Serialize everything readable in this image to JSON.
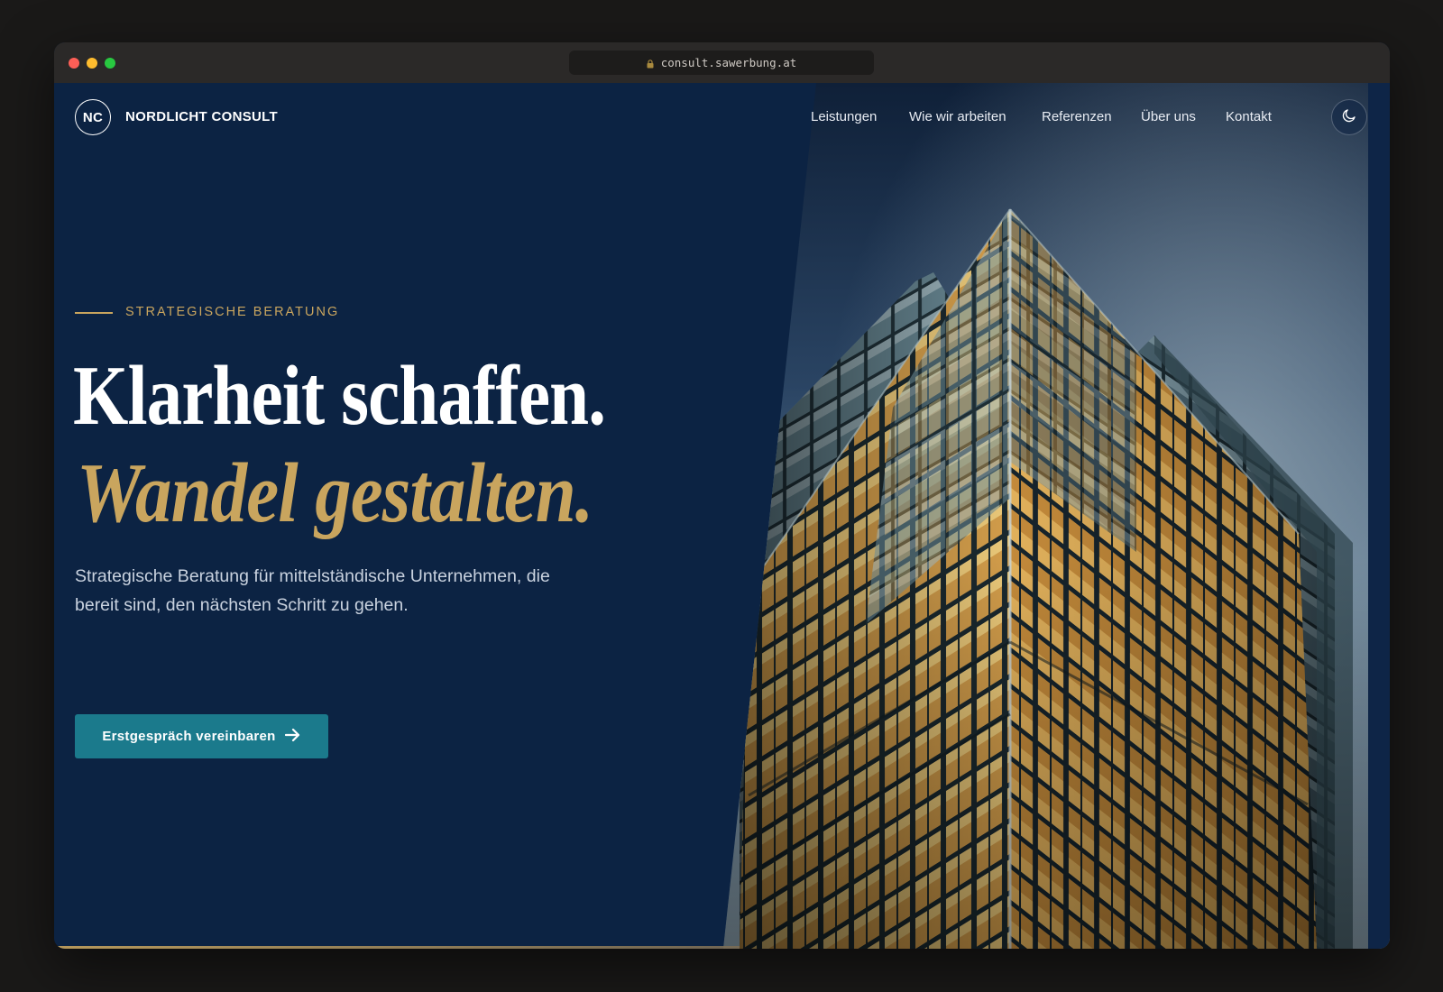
{
  "browser": {
    "url": "consult.sawerbung.at"
  },
  "header": {
    "logo_mark": "NC",
    "brand": "NORDLICHT CONSULT",
    "nav": [
      {
        "label": "Leistungen"
      },
      {
        "label": "Wie wir arbeiten"
      },
      {
        "label": "Referenzen"
      },
      {
        "label": "Über uns"
      },
      {
        "label": "Kontakt"
      }
    ],
    "theme_toggle_icon": "moon-icon"
  },
  "hero": {
    "eyebrow": "STRATEGISCHE BERATUNG",
    "headline_line1": "Klarheit schaffen.",
    "headline_line2": "Wandel gestalten.",
    "lead": "Strategische Beratung für mittelständische Unternehmen, die bereit sind, den nächsten Schritt zu gehen.",
    "cta_label": "Erstgespräch vereinbaren",
    "cta_icon": "arrow-right-icon",
    "image_subject": "glass-office-tower-at-dusk"
  },
  "colors": {
    "navy": "#0c2343",
    "gold": "#c9a55e",
    "teal": "#1b7a8c"
  }
}
